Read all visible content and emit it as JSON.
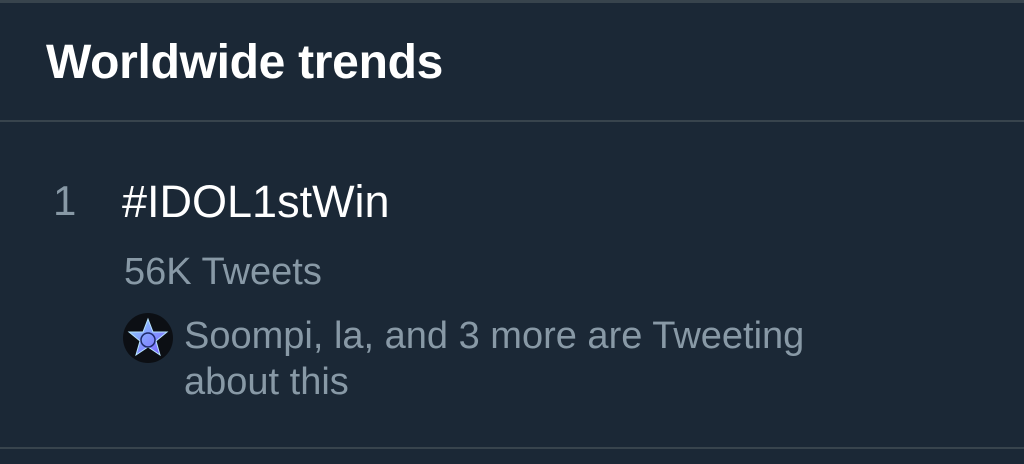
{
  "header": {
    "title": "Worldwide trends"
  },
  "trends": [
    {
      "rank": "1",
      "name": "#IDOL1stWin",
      "tweet_count": "56K Tweets",
      "tweeting_text": "Soompi, la, and 3 more are Tweeting about this",
      "avatar_icon": "star-badge-icon"
    }
  ],
  "colors": {
    "background": "#1b2836",
    "divider": "#38444d",
    "primary_text": "#ffffff",
    "secondary_text": "#8899a6"
  }
}
